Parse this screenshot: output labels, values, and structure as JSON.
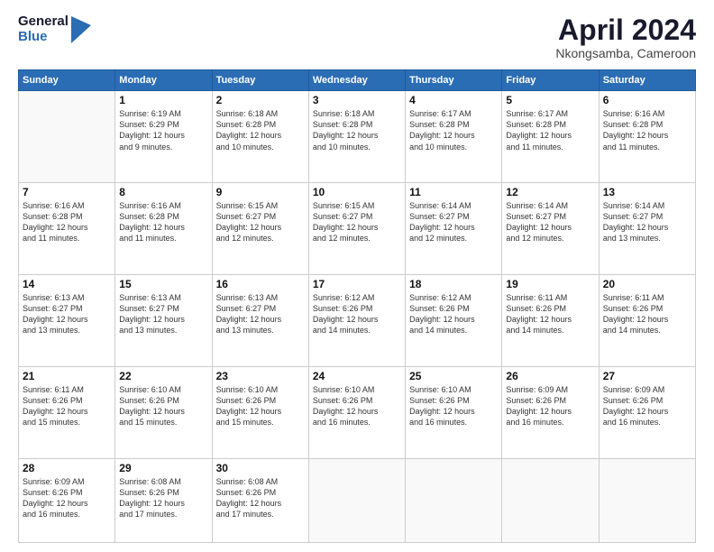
{
  "logo": {
    "general": "General",
    "blue": "Blue"
  },
  "title": "April 2024",
  "subtitle": "Nkongsamba, Cameroon",
  "days_of_week": [
    "Sunday",
    "Monday",
    "Tuesday",
    "Wednesday",
    "Thursday",
    "Friday",
    "Saturday"
  ],
  "weeks": [
    [
      {
        "day": "",
        "text": ""
      },
      {
        "day": "1",
        "text": "Sunrise: 6:19 AM\nSunset: 6:29 PM\nDaylight: 12 hours\nand 9 minutes."
      },
      {
        "day": "2",
        "text": "Sunrise: 6:18 AM\nSunset: 6:28 PM\nDaylight: 12 hours\nand 10 minutes."
      },
      {
        "day": "3",
        "text": "Sunrise: 6:18 AM\nSunset: 6:28 PM\nDaylight: 12 hours\nand 10 minutes."
      },
      {
        "day": "4",
        "text": "Sunrise: 6:17 AM\nSunset: 6:28 PM\nDaylight: 12 hours\nand 10 minutes."
      },
      {
        "day": "5",
        "text": "Sunrise: 6:17 AM\nSunset: 6:28 PM\nDaylight: 12 hours\nand 11 minutes."
      },
      {
        "day": "6",
        "text": "Sunrise: 6:16 AM\nSunset: 6:28 PM\nDaylight: 12 hours\nand 11 minutes."
      }
    ],
    [
      {
        "day": "7",
        "text": "Sunrise: 6:16 AM\nSunset: 6:28 PM\nDaylight: 12 hours\nand 11 minutes."
      },
      {
        "day": "8",
        "text": "Sunrise: 6:16 AM\nSunset: 6:28 PM\nDaylight: 12 hours\nand 11 minutes."
      },
      {
        "day": "9",
        "text": "Sunrise: 6:15 AM\nSunset: 6:27 PM\nDaylight: 12 hours\nand 12 minutes."
      },
      {
        "day": "10",
        "text": "Sunrise: 6:15 AM\nSunset: 6:27 PM\nDaylight: 12 hours\nand 12 minutes."
      },
      {
        "day": "11",
        "text": "Sunrise: 6:14 AM\nSunset: 6:27 PM\nDaylight: 12 hours\nand 12 minutes."
      },
      {
        "day": "12",
        "text": "Sunrise: 6:14 AM\nSunset: 6:27 PM\nDaylight: 12 hours\nand 12 minutes."
      },
      {
        "day": "13",
        "text": "Sunrise: 6:14 AM\nSunset: 6:27 PM\nDaylight: 12 hours\nand 13 minutes."
      }
    ],
    [
      {
        "day": "14",
        "text": "Sunrise: 6:13 AM\nSunset: 6:27 PM\nDaylight: 12 hours\nand 13 minutes."
      },
      {
        "day": "15",
        "text": "Sunrise: 6:13 AM\nSunset: 6:27 PM\nDaylight: 12 hours\nand 13 minutes."
      },
      {
        "day": "16",
        "text": "Sunrise: 6:13 AM\nSunset: 6:27 PM\nDaylight: 12 hours\nand 13 minutes."
      },
      {
        "day": "17",
        "text": "Sunrise: 6:12 AM\nSunset: 6:26 PM\nDaylight: 12 hours\nand 14 minutes."
      },
      {
        "day": "18",
        "text": "Sunrise: 6:12 AM\nSunset: 6:26 PM\nDaylight: 12 hours\nand 14 minutes."
      },
      {
        "day": "19",
        "text": "Sunrise: 6:11 AM\nSunset: 6:26 PM\nDaylight: 12 hours\nand 14 minutes."
      },
      {
        "day": "20",
        "text": "Sunrise: 6:11 AM\nSunset: 6:26 PM\nDaylight: 12 hours\nand 14 minutes."
      }
    ],
    [
      {
        "day": "21",
        "text": "Sunrise: 6:11 AM\nSunset: 6:26 PM\nDaylight: 12 hours\nand 15 minutes."
      },
      {
        "day": "22",
        "text": "Sunrise: 6:10 AM\nSunset: 6:26 PM\nDaylight: 12 hours\nand 15 minutes."
      },
      {
        "day": "23",
        "text": "Sunrise: 6:10 AM\nSunset: 6:26 PM\nDaylight: 12 hours\nand 15 minutes."
      },
      {
        "day": "24",
        "text": "Sunrise: 6:10 AM\nSunset: 6:26 PM\nDaylight: 12 hours\nand 16 minutes."
      },
      {
        "day": "25",
        "text": "Sunrise: 6:10 AM\nSunset: 6:26 PM\nDaylight: 12 hours\nand 16 minutes."
      },
      {
        "day": "26",
        "text": "Sunrise: 6:09 AM\nSunset: 6:26 PM\nDaylight: 12 hours\nand 16 minutes."
      },
      {
        "day": "27",
        "text": "Sunrise: 6:09 AM\nSunset: 6:26 PM\nDaylight: 12 hours\nand 16 minutes."
      }
    ],
    [
      {
        "day": "28",
        "text": "Sunrise: 6:09 AM\nSunset: 6:26 PM\nDaylight: 12 hours\nand 16 minutes."
      },
      {
        "day": "29",
        "text": "Sunrise: 6:08 AM\nSunset: 6:26 PM\nDaylight: 12 hours\nand 17 minutes."
      },
      {
        "day": "30",
        "text": "Sunrise: 6:08 AM\nSunset: 6:26 PM\nDaylight: 12 hours\nand 17 minutes."
      },
      {
        "day": "",
        "text": ""
      },
      {
        "day": "",
        "text": ""
      },
      {
        "day": "",
        "text": ""
      },
      {
        "day": "",
        "text": ""
      }
    ]
  ]
}
